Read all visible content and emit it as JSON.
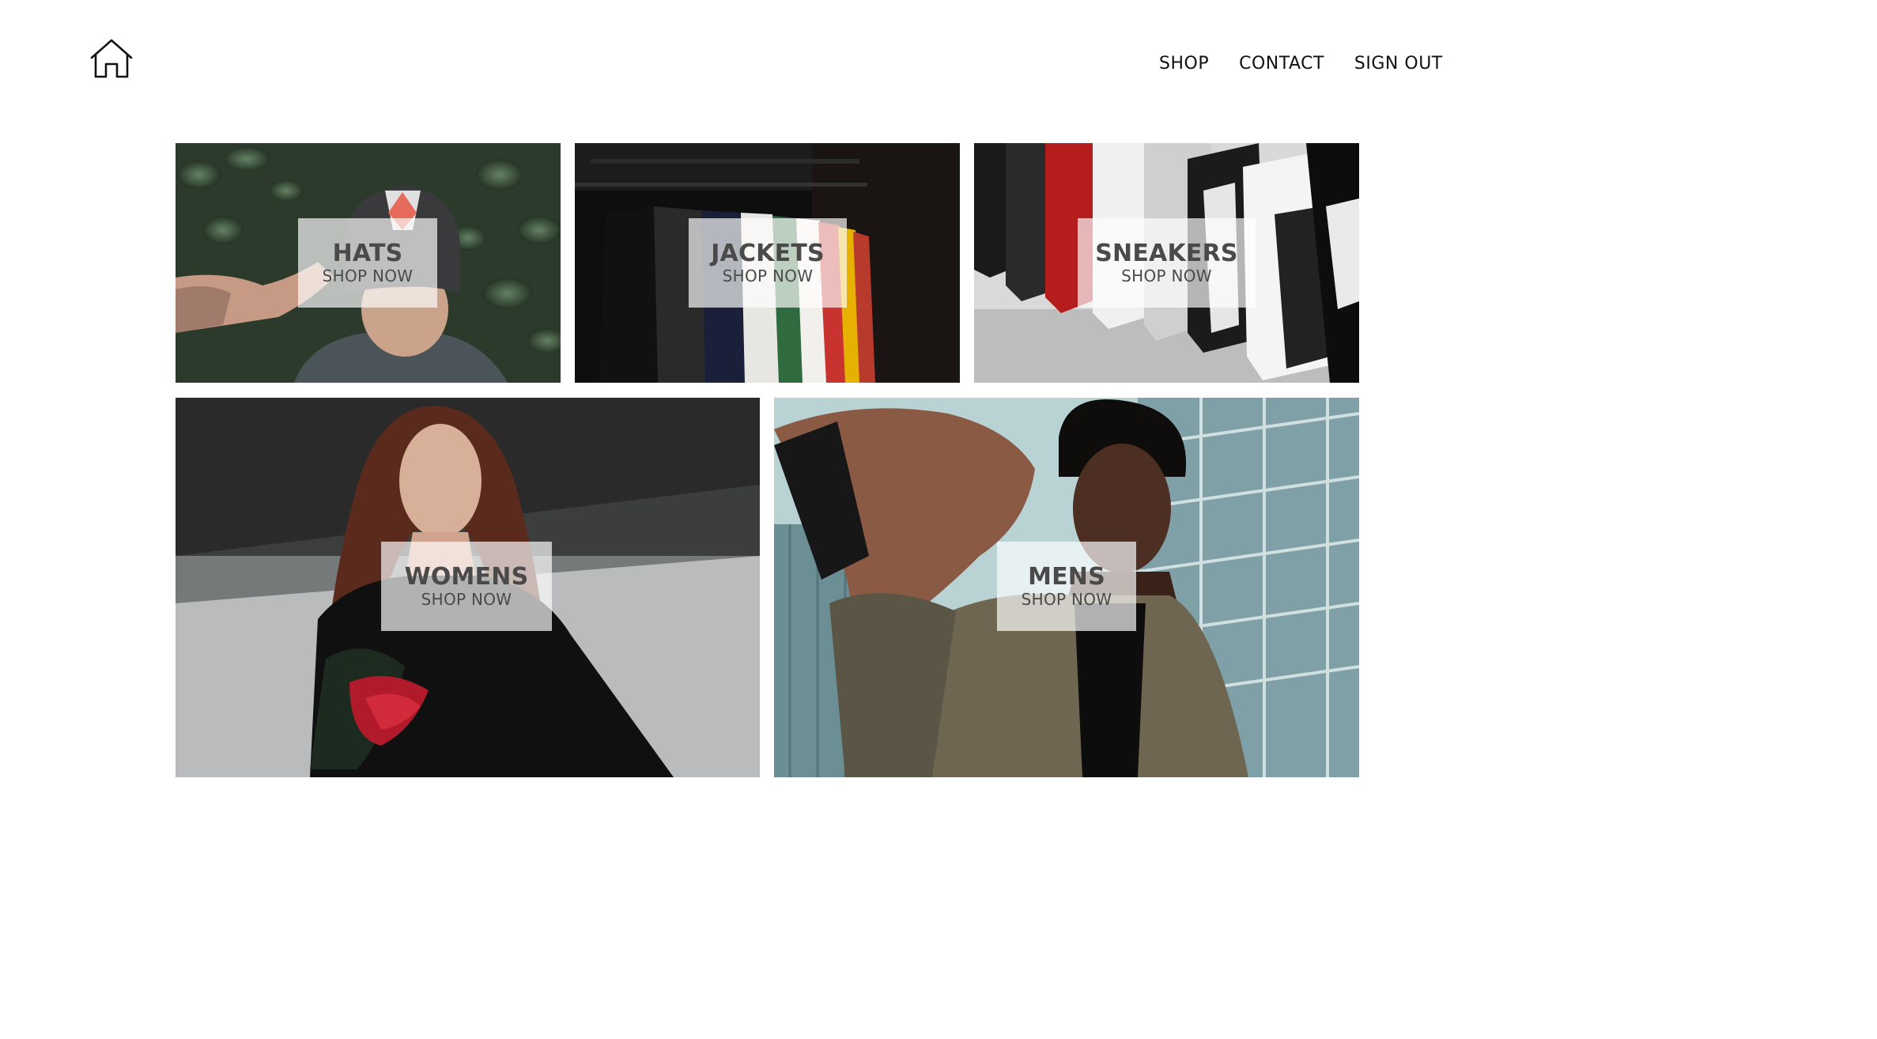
{
  "nav": {
    "logo_icon": "home-icon",
    "links": [
      "SHOP",
      "CONTACT",
      "SIGN OUT"
    ]
  },
  "directory": {
    "sections": [
      {
        "title": "HATS",
        "subtitle": "SHOP NOW"
      },
      {
        "title": "JACKETS",
        "subtitle": "SHOP NOW"
      },
      {
        "title": "SNEAKERS",
        "subtitle": "SHOP NOW"
      },
      {
        "title": "WOMENS",
        "subtitle": "SHOP NOW"
      },
      {
        "title": "MENS",
        "subtitle": "SHOP NOW"
      }
    ]
  },
  "colors": {
    "text": "#111111",
    "label_text": "#4a4a4a",
    "label_bg": "rgba(255,255,255,0.68)"
  }
}
